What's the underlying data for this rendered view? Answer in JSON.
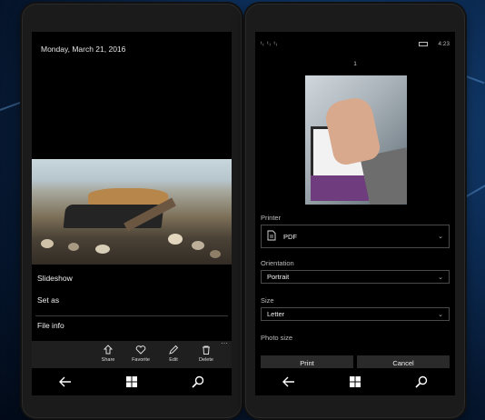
{
  "colors": {
    "background": "#0d2f5a",
    "phone": "#1b1b1b",
    "screen": "#000000",
    "accent": "#ffffff"
  },
  "left_phone": {
    "date": "Monday, March 21, 2016",
    "menu": [
      "Slideshow",
      "Set as",
      "File info"
    ],
    "appbar": [
      {
        "label": "Share",
        "icon": "share-icon"
      },
      {
        "label": "Favorite",
        "icon": "heart-icon"
      },
      {
        "label": "Edit",
        "icon": "pencil-icon"
      },
      {
        "label": "Delete",
        "icon": "trash-icon"
      }
    ],
    "more": "···"
  },
  "right_phone": {
    "status": {
      "signal": "ᵗᵢ ᵗᵢ ᵗᵢ",
      "time": "4:23"
    },
    "page": "1",
    "printer": {
      "label": "Printer",
      "value": "PDF"
    },
    "orientation": {
      "label": "Orientation",
      "value": "Portrait"
    },
    "size": {
      "label": "Size",
      "value": "Letter"
    },
    "photo_size": {
      "label": "Photo size"
    },
    "buttons": {
      "print": "Print",
      "cancel": "Cancel"
    }
  },
  "navbar": {
    "icons": [
      "back-arrow-icon",
      "windows-icon",
      "search-icon"
    ]
  }
}
